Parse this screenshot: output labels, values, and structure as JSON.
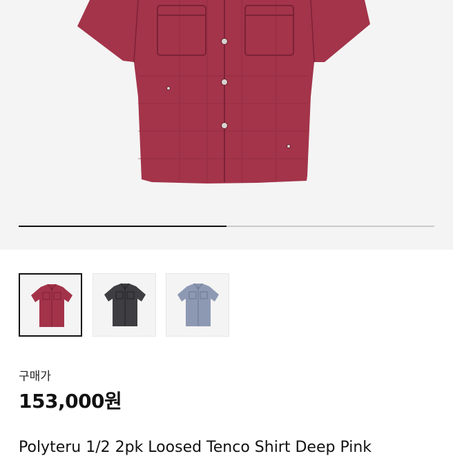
{
  "gallery": {
    "progress_fraction": 0.5,
    "thumbnails": [
      {
        "name": "deep-pink",
        "color": "#a33349",
        "dark": "#7d2236",
        "selected": true
      },
      {
        "name": "black",
        "color": "#3e3e42",
        "dark": "#232326",
        "selected": false
      },
      {
        "name": "blue-gray",
        "color": "#8d99b3",
        "dark": "#6c7891",
        "selected": false
      }
    ],
    "main_color": "#a3344a",
    "main_dark": "#7d2236",
    "button_color": "#d7d2cf"
  },
  "price": {
    "label": "구매가",
    "value": "153,000원"
  },
  "product": {
    "name": "Polyteru 1/2 2pk Loosed Tenco Shirt Deep Pink"
  }
}
